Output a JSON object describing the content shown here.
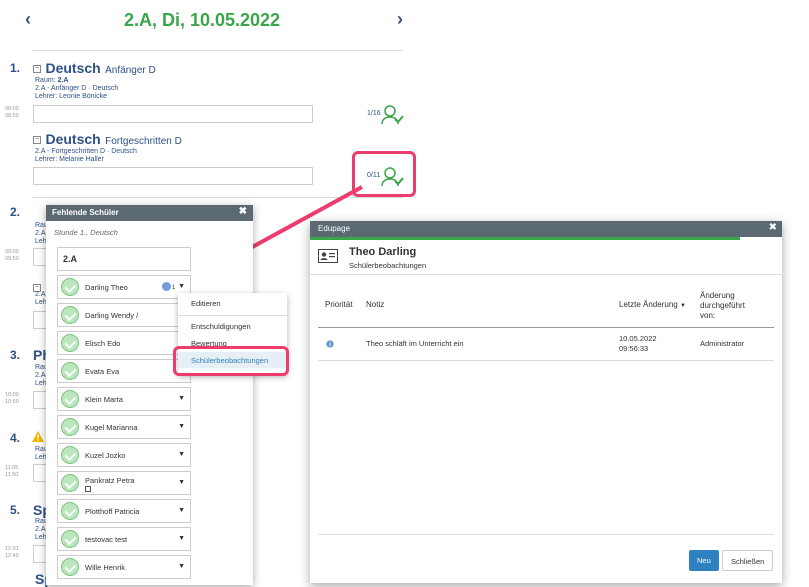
{
  "header": {
    "title": "2.A, Di, 10.05.2022",
    "prev": "‹",
    "next": "›"
  },
  "periods": [
    {
      "num": "1.",
      "lessons": [
        {
          "subject": "Deutsch",
          "level": "Anfänger D",
          "room_label": "Raum:",
          "room": "2.A",
          "group": "2.A - Anfänger D · Deutsch",
          "teacher_label": "Lehrer:",
          "teacher": "Leonie Bönicke",
          "count": "1/16",
          "times": [
            "08:00",
            "08:50"
          ]
        },
        {
          "subject": "Deutsch",
          "level": "Fortgeschritten D",
          "group": "2.A - Fortgeschritten D · Deutsch",
          "teacher_label": "Lehrer:",
          "teacher": "Melanie Haller",
          "count": "0/11"
        }
      ]
    },
    {
      "num": "2.",
      "frag": [
        "Rau",
        "2.A",
        "Lehr"
      ],
      "times": [
        "09:00",
        "09:50"
      ],
      "frag2": [
        "2.A",
        "Lehr"
      ]
    },
    {
      "num": "3.",
      "subj": "Ph",
      "frag": [
        "Rau",
        "2.A",
        "Lehr"
      ],
      "times": [
        "10:00",
        "10:50"
      ]
    },
    {
      "num": "4.",
      "frag": [
        "Rau",
        "Lehr"
      ],
      "times": [
        "11:05",
        "11:50"
      ]
    },
    {
      "num": "5.",
      "subj": "Sp",
      "frag": [
        "Rau",
        "2.A",
        "Lehr"
      ],
      "times": [
        "12:01",
        "12:40"
      ]
    },
    {
      "frag_bottom": "Sp"
    }
  ],
  "panel": {
    "title": "Fehlende Schüler",
    "close": "✖",
    "subtitle": "Stunde 1., Deutsch",
    "class": "2.A",
    "students": [
      {
        "name": "Darling Theo",
        "badge": "1",
        "caret": "▼"
      },
      {
        "name": "Darling Wendy /",
        "caret": ""
      },
      {
        "name": "Elisch Edo",
        "caret": ""
      },
      {
        "name": "Evata Eva",
        "caret": ""
      },
      {
        "name": "Klein Marta",
        "caret": "▼"
      },
      {
        "name": "Kugel Marianna",
        "caret": "▼"
      },
      {
        "name": "Kuzel Jozko",
        "caret": "▼"
      },
      {
        "name": "Pankratz Petra",
        "caret": "▼"
      },
      {
        "name": "Plotthoff Patricia",
        "caret": "▼"
      },
      {
        "name": "testovac test",
        "caret": "▼"
      },
      {
        "name": "Wille Henrik",
        "caret": "▼"
      }
    ]
  },
  "menu": {
    "items": [
      "Editieren",
      "Entschuldigungen",
      "Bewertung",
      "Schülerbeobachtungen"
    ]
  },
  "dialog": {
    "title": "Edupage",
    "close": "✖",
    "name": "Theo Darling",
    "subtitle": "Schülerbeobachtungen",
    "columns": {
      "priority": "Priorität",
      "note": "Notiz",
      "changed": "Letzte Änderung",
      "sort": "▼",
      "by": [
        "Änderung",
        "durchgeführt",
        "von:"
      ]
    },
    "rows": [
      {
        "note": "Theo schläft im Unterricht ein",
        "date": "10.05.2022",
        "time": "09:56:33",
        "by": "Administrator"
      }
    ],
    "new_btn": "Neu",
    "close_btn": "Schließen"
  },
  "colors": {
    "accent": "#3aa64a",
    "highlight": "#ec3d6e",
    "header": "#5b6a72",
    "primary": "#2e82c1"
  }
}
